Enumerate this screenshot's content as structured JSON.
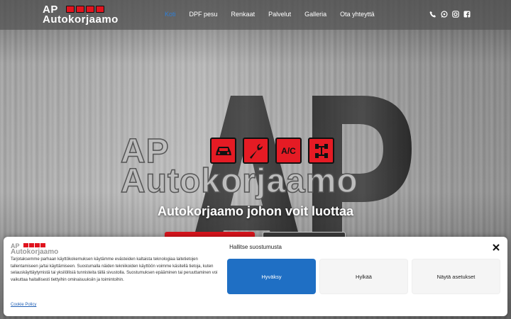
{
  "header": {
    "logo_line1": "AP",
    "logo_line2": "Autokorjaamo",
    "nav": [
      {
        "label": "Koti",
        "active": true
      },
      {
        "label": "DPF pesu"
      },
      {
        "label": "Renkaat"
      },
      {
        "label": "Palvelut"
      },
      {
        "label": "Galleria"
      },
      {
        "label": "Ota yhteyttä"
      }
    ],
    "social_icons": [
      "phone-icon",
      "whatsapp-icon",
      "instagram-icon",
      "facebook-icon"
    ]
  },
  "hero": {
    "logo_line1": "AP",
    "logo_line2": "Autokorjaamo",
    "service_icons": [
      "car-icon",
      "wrench-icon",
      "ac-icon",
      "axle-icon"
    ],
    "ac_label": "A/C",
    "tagline": "Autokorjaamo johon voit luottaa"
  },
  "consent": {
    "logo_line1": "AP",
    "logo_line2": "Autokorjaamo",
    "title": "Hallitse suostumusta",
    "text": "Tarjotaksemme parhaan käyttökokemuksen käytämme evästeiden kaltaista teknologiaa laitetietojen tallentamiseen ja/tai käyttämiseen. Suostumalla näiden tekniikoiden käyttöön voimme käsitellä tietoja, kuten selauskäyttäytymistä tai yksilöllisiä tunnisteita tällä sivustolla. Suostumuksen epääminen tai peruuttaminen voi vaikuttaa haitallisesti tiettyihin ominaisuuksiin ja toimintoihin.",
    "accept": "Hyväksy",
    "deny": "Hylkää",
    "settings": "Näytä asetukset",
    "policy_link": "Cookie Policy"
  },
  "colors": {
    "accent": "#2f7fd6",
    "brand_red": "#e51b24",
    "accept_blue": "#1f6fc4"
  }
}
